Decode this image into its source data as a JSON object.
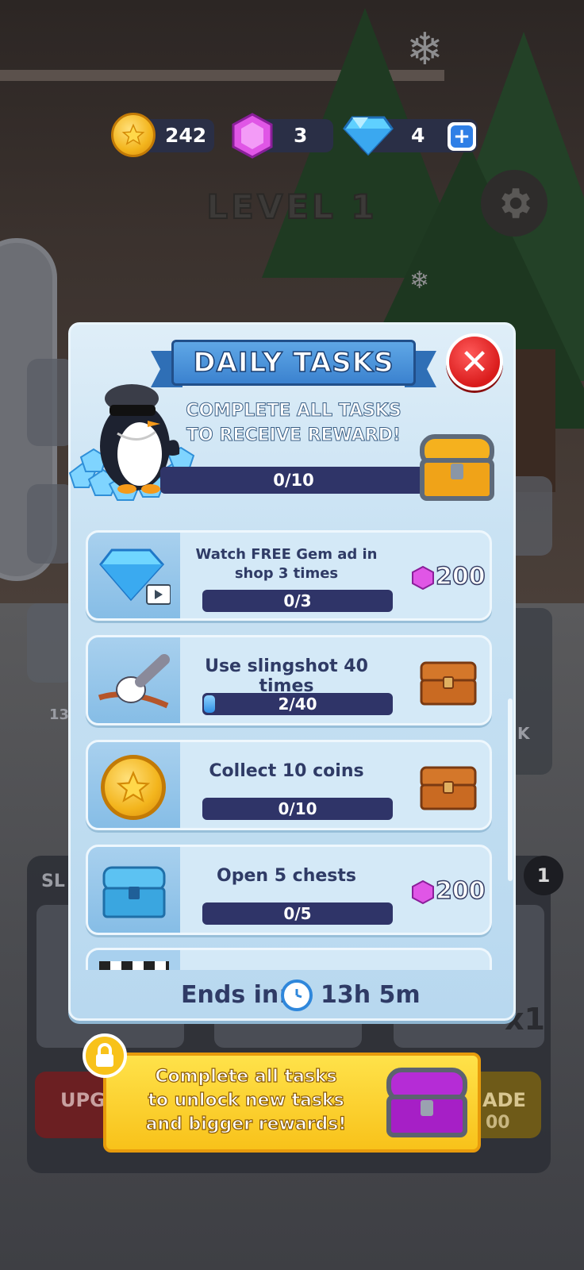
{
  "hud": {
    "coins": "242",
    "pink_gems": "3",
    "diamonds": "4",
    "plus": "+"
  },
  "level": {
    "title": "LEVEL 1"
  },
  "panel": {
    "title": "DAILY TASKS",
    "close": "✕",
    "subtitle_line1": "COMPLETE ALL TASKS",
    "subtitle_line2": "TO RECEIVE REWARD!",
    "progress_text": "0/10",
    "ends_label": "Ends in:",
    "ends_value": "13h 5m"
  },
  "tasks": [
    {
      "title": "Watch FREE Gem ad in shop 3 times",
      "progress_text": "0/3",
      "progress": 0.0,
      "reward_type": "pink-gem",
      "reward_amount": "200"
    },
    {
      "title": "Use slingshot 40 times",
      "progress_text": "2/40",
      "progress": 0.05,
      "reward_type": "wooden-chest"
    },
    {
      "title": "Collect 10 coins",
      "progress_text": "0/10",
      "progress": 0.0,
      "reward_type": "wooden-chest"
    },
    {
      "title": "Open 5 chests",
      "progress_text": "0/5",
      "progress": 0.0,
      "reward_type": "pink-gem",
      "reward_amount": "200"
    }
  ],
  "banner": {
    "line1": "Complete all tasks",
    "line2": "to unlock new tasks",
    "line3": "and bigger rewards!"
  },
  "background": {
    "badge": "1",
    "multiplier": "x1",
    "side_label_left": "UPG",
    "side_label_right": "ADE",
    "count_left": "13",
    "ghost_small": "SL",
    "ghost_k": "K",
    "ghost_zero": "00"
  },
  "colors": {
    "accent_blue": "#3b82cf",
    "close_red": "#d91b1b",
    "bar_navy": "#2f3468",
    "banner_yellow": "#f8c21a"
  }
}
